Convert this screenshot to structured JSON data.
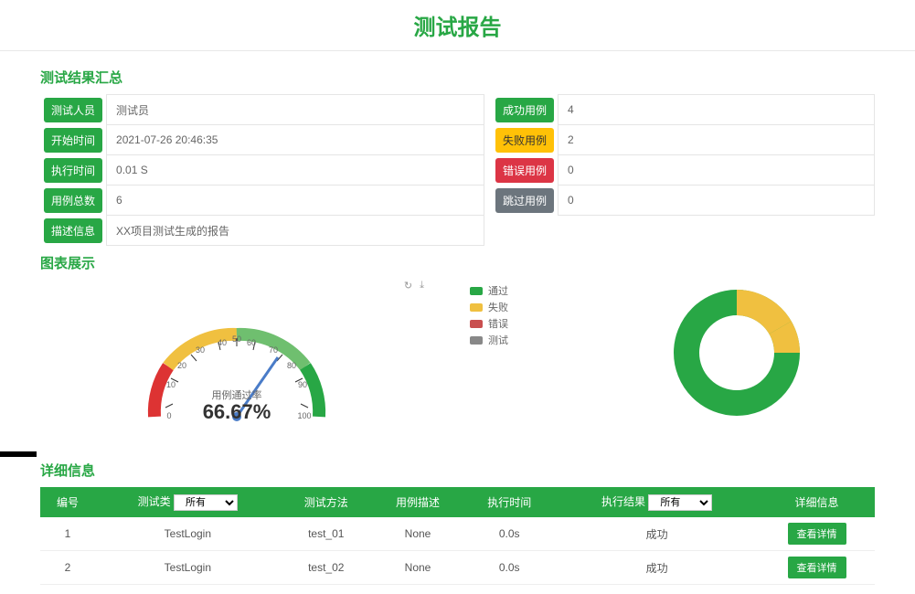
{
  "header": {
    "title": "测试报告"
  },
  "summary": {
    "heading": "测试结果汇总",
    "left": [
      {
        "label": "测试人员",
        "value": "测试员"
      },
      {
        "label": "开始时间",
        "value": "2021-07-26 20:46:35"
      },
      {
        "label": "执行时间",
        "value": "0.01 S"
      },
      {
        "label": "用例总数",
        "value": "6"
      },
      {
        "label": "描述信息",
        "value": "XX项目测试生成的报告"
      }
    ],
    "right": [
      {
        "label": "成功用例",
        "value": "4",
        "cls": "g",
        "vcls": "cnt-g"
      },
      {
        "label": "失败用例",
        "value": "2",
        "cls": "y",
        "vcls": "cnt-y"
      },
      {
        "label": "错误用例",
        "value": "0",
        "cls": "r",
        "vcls": "cnt-r"
      },
      {
        "label": "跳过用例",
        "value": "0",
        "cls": "gray",
        "vcls": "cnt-gray"
      }
    ]
  },
  "charts": {
    "heading": "图表展示",
    "legend": [
      {
        "label": "通过",
        "color": "#28a745"
      },
      {
        "label": "失败",
        "color": "#f0c040"
      },
      {
        "label": "错误",
        "color": "#c94f4f"
      },
      {
        "label": "测试",
        "color": "#888"
      }
    ],
    "gauge": {
      "label": "用例通过率",
      "value": "66.67%"
    }
  },
  "details": {
    "heading": "详细信息",
    "filter": "所有",
    "headers": [
      "编号",
      "测试类",
      "测试方法",
      "用例描述",
      "执行时间",
      "执行结果",
      "详细信息"
    ],
    "rows": [
      {
        "id": "1",
        "cls": "TestLogin",
        "method": "test_01",
        "desc": "None",
        "time": "0.0s",
        "result": "成功",
        "btn": "查看详情"
      },
      {
        "id": "2",
        "cls": "TestLogin",
        "method": "test_02",
        "desc": "None",
        "time": "0.0s",
        "result": "成功",
        "btn": "查看详情"
      }
    ]
  },
  "chart_data": [
    {
      "type": "pie",
      "title": "用例通过率",
      "series": [
        {
          "name": "通过",
          "value": 4
        },
        {
          "name": "失败",
          "value": 2
        },
        {
          "name": "错误",
          "value": 0
        },
        {
          "name": "测试",
          "value": 0
        }
      ]
    },
    {
      "type": "bar",
      "title": "",
      "categories": [
        "用例通过率"
      ],
      "values": [
        66.67
      ],
      "ylim": [
        0,
        100
      ]
    }
  ]
}
